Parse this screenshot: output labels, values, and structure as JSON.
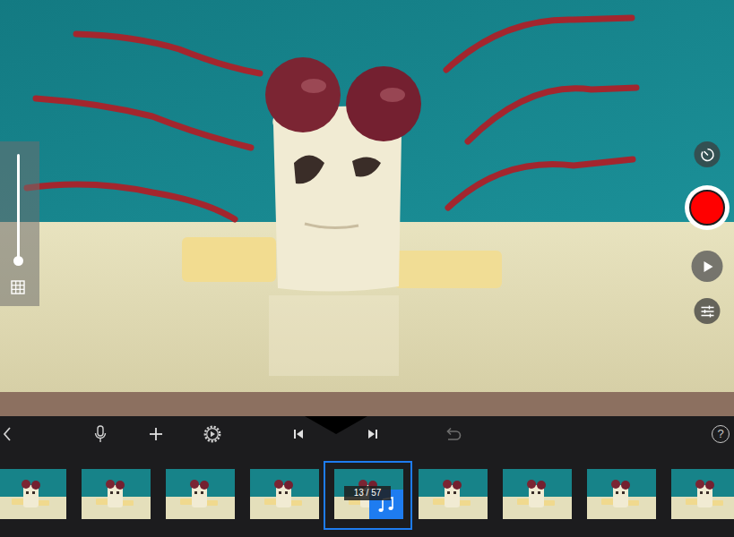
{
  "viewer": {
    "zoom": {
      "level": 0
    }
  },
  "toolbar": {
    "help": "?"
  },
  "filmstrip": {
    "counter": "13 / 57",
    "frames": [
      {
        "selected": false
      },
      {
        "selected": false
      },
      {
        "selected": false
      },
      {
        "selected": false
      },
      {
        "selected": true
      },
      {
        "selected": false
      },
      {
        "selected": false
      },
      {
        "selected": false
      },
      {
        "selected": false
      }
    ]
  }
}
